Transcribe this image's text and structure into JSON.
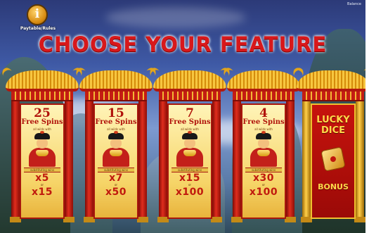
{
  "header": {
    "info_button_glyph": "i",
    "info_caption": "Paytable/Rules",
    "corner_text": "Balance",
    "title": "CHOOSE YOUR FEATURE"
  },
  "features": [
    {
      "spins": "25",
      "label": "Free Spins",
      "note": "all wilds with",
      "substitute_note": "substituting wins",
      "mult_a": "x5",
      "or": "or",
      "mult_b": "x15"
    },
    {
      "spins": "15",
      "label": "Free Spins",
      "note": "all wilds with",
      "substitute_note": "substituting wins",
      "mult_a": "x7",
      "or": "or",
      "mult_b": "x50"
    },
    {
      "spins": "7",
      "label": "Free Spins",
      "note": "all wilds with",
      "substitute_note": "substituting wins",
      "mult_a": "x15",
      "or": "or",
      "mult_b": "x100"
    },
    {
      "spins": "4",
      "label": "Free Spins",
      "note": "all wilds with",
      "substitute_note": "substituting wins",
      "mult_a": "x30",
      "or": "or",
      "mult_b": "x100"
    }
  ],
  "bonus": {
    "title_line1": "LUCKY",
    "title_line2": "DICE",
    "label": "BONUS"
  },
  "colors": {
    "title_red": "#d8181b",
    "gold": "#f2b835",
    "pillar_red": "#c41c13"
  }
}
